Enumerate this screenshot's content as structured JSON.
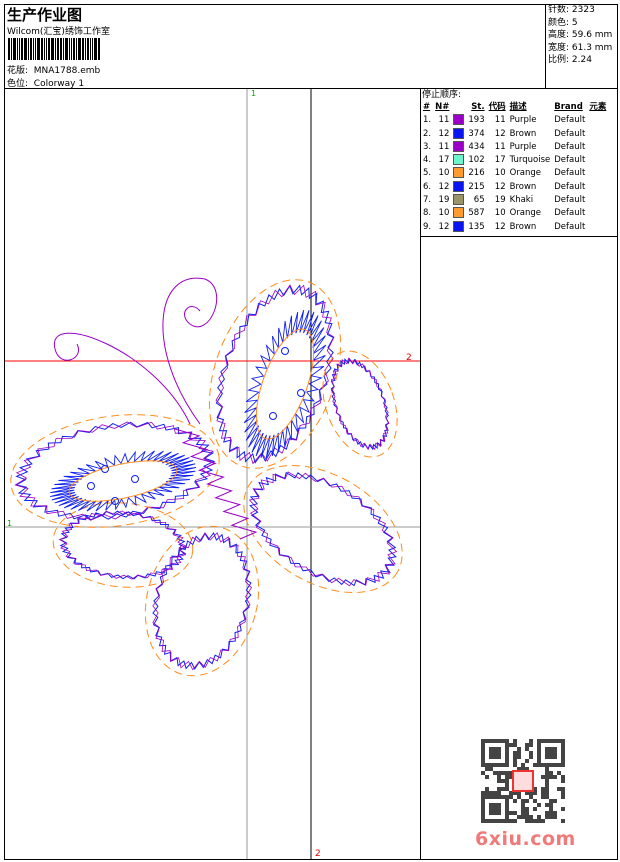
{
  "header": {
    "title": "生产作业图",
    "studio": "Wilcom(汇宝)绣饰工作室",
    "design_label": "花版:",
    "design_value": "MNA1788.emb",
    "colorway_label": "色位:",
    "colorway_value": "Colorway 1"
  },
  "stats": {
    "stitches": "针数: 2323",
    "colors": "颜色: 5",
    "height": "高度: 59.6 mm",
    "width": "宽度: 61.3 mm",
    "scale": "比例: 2.24"
  },
  "stop_sequence": {
    "title": "停止顺序:",
    "columns": [
      "#",
      "N#",
      "St.",
      "代码",
      "描述",
      "Brand",
      "元素"
    ],
    "rows": [
      {
        "idx": "1.",
        "n": "11",
        "color": "#9b00c8",
        "st": "193",
        "code": "11",
        "desc": "Purple",
        "brand": "Default"
      },
      {
        "idx": "2.",
        "n": "12",
        "color": "#0a14f0",
        "st": "374",
        "code": "12",
        "desc": "Brown",
        "brand": "Default"
      },
      {
        "idx": "3.",
        "n": "11",
        "color": "#9b00c8",
        "st": "434",
        "code": "11",
        "desc": "Purple",
        "brand": "Default"
      },
      {
        "idx": "4.",
        "n": "17",
        "color": "#6cf5cc",
        "st": "102",
        "code": "17",
        "desc": "Turquoise",
        "brand": "Default"
      },
      {
        "idx": "5.",
        "n": "10",
        "color": "#ff9a30",
        "st": "216",
        "code": "10",
        "desc": "Orange",
        "brand": "Default"
      },
      {
        "idx": "6.",
        "n": "12",
        "color": "#0a14f0",
        "st": "215",
        "code": "12",
        "desc": "Brown",
        "brand": "Default"
      },
      {
        "idx": "7.",
        "n": "19",
        "color": "#9a9468",
        "st": "65",
        "code": "19",
        "desc": "Khaki",
        "brand": "Default"
      },
      {
        "idx": "8.",
        "n": "10",
        "color": "#ff9a30",
        "st": "587",
        "code": "10",
        "desc": "Orange",
        "brand": "Default"
      },
      {
        "idx": "9.",
        "n": "12",
        "color": "#0a14f0",
        "st": "135",
        "code": "12",
        "desc": "Brown",
        "brand": "Default"
      }
    ]
  },
  "guides": {
    "v1": "1",
    "v2": "2",
    "h1": "1",
    "h2": "2"
  },
  "watermark": {
    "text": "6xiu.com",
    "seal": "以图制版"
  }
}
